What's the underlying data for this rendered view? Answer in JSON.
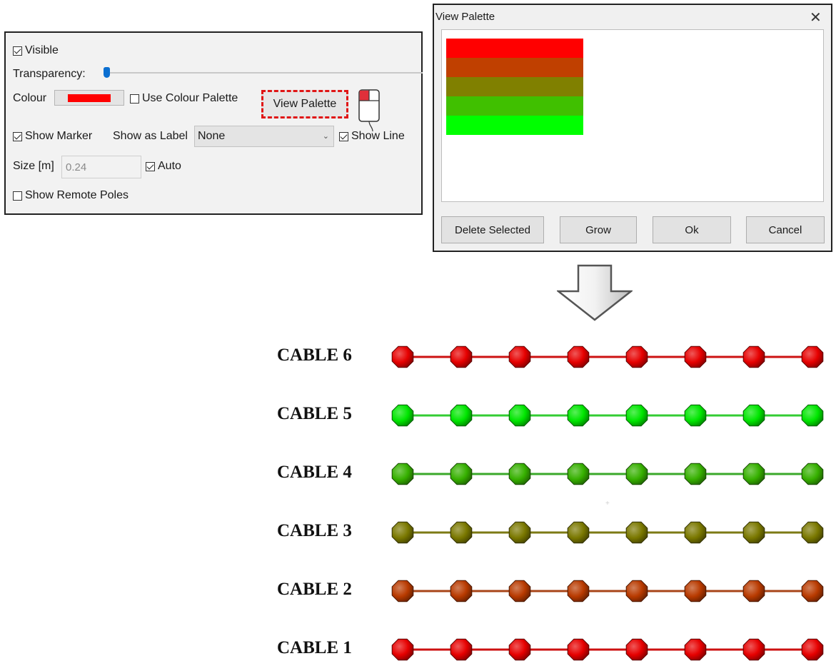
{
  "panel": {
    "visible": {
      "label": "Visible",
      "checked": true
    },
    "transparency_label": "Transparency:",
    "colour_label": "Colour",
    "colour_value": "#ff0000",
    "use_palette": {
      "label": "Use Colour Palette",
      "checked": false
    },
    "view_palette_button": "View Palette",
    "show_marker": {
      "label": "Show Marker",
      "checked": true
    },
    "show_as_label": "Show as Label",
    "label_select_value": "None",
    "show_line": {
      "label": "Show Line",
      "checked": true
    },
    "size_label": "Size [m]",
    "size_value": "0.24",
    "auto": {
      "label": "Auto",
      "checked": true
    },
    "show_remote_poles": {
      "label": "Show Remote Poles",
      "checked": false
    }
  },
  "dialog": {
    "title": "View Palette",
    "close_icon": "close-icon",
    "palette_colors": [
      "#ff0000",
      "#c04000",
      "#808000",
      "#40c000",
      "#00ff00"
    ],
    "buttons": {
      "delete": "Delete Selected",
      "grow": "Grow",
      "ok": "Ok",
      "cancel": "Cancel"
    }
  },
  "cables": [
    {
      "label": "CABLE 6",
      "color": "#e60000",
      "line": "#cc1111"
    },
    {
      "label": "CABLE 5",
      "color": "#00e600",
      "line": "#33cc33"
    },
    {
      "label": "CABLE 4",
      "color": "#36b000",
      "line": "#3aa82a"
    },
    {
      "label": "CABLE 3",
      "color": "#7a7800",
      "line": "#7c7a14"
    },
    {
      "label": "CABLE 2",
      "color": "#b83a00",
      "line": "#a84418"
    },
    {
      "label": "CABLE 1",
      "color": "#e60000",
      "line": "#cc1111"
    }
  ],
  "markers_per_cable": 8
}
